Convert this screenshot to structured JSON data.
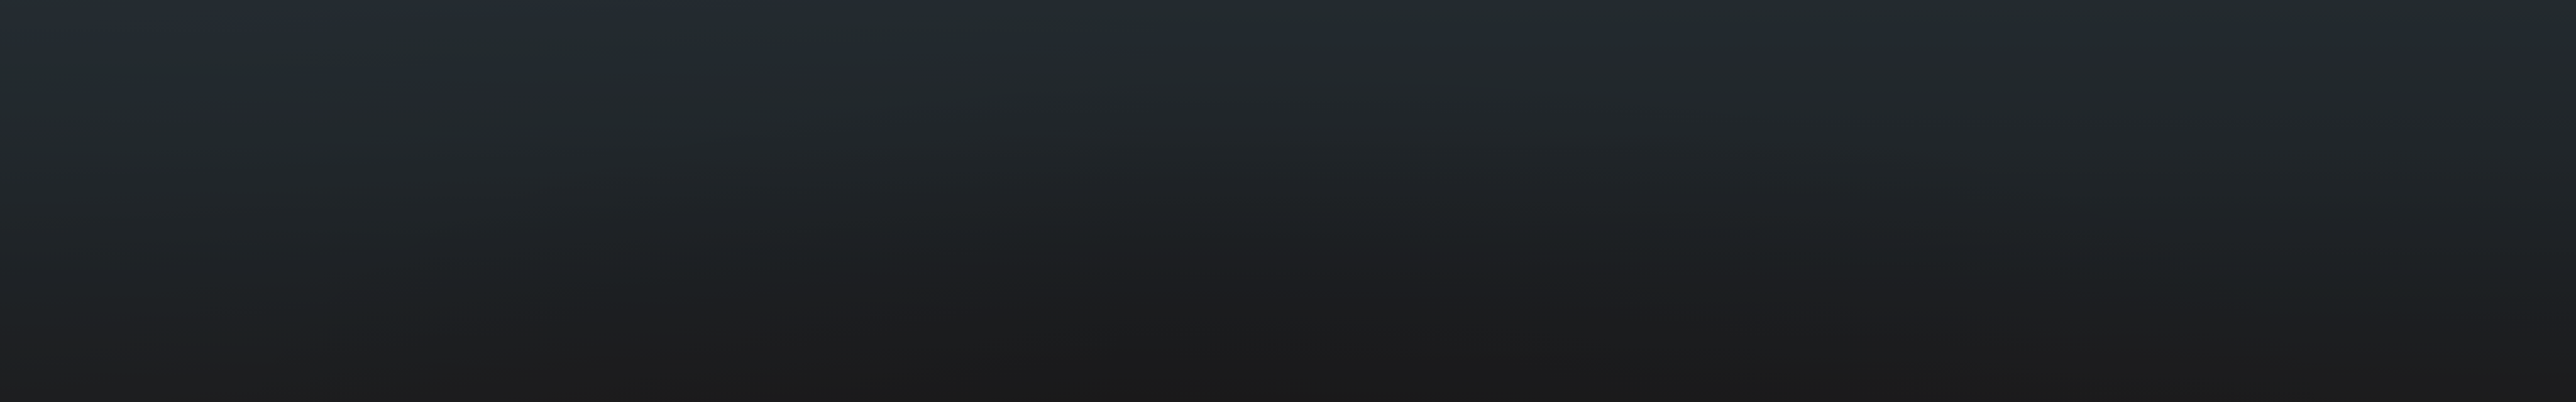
{
  "background": {
    "colors": {
      "top": "#232a2f",
      "middle": "#20262a",
      "lower": "#1c1f22",
      "bottom": "#1b1a1b"
    },
    "direction": "vertical"
  }
}
